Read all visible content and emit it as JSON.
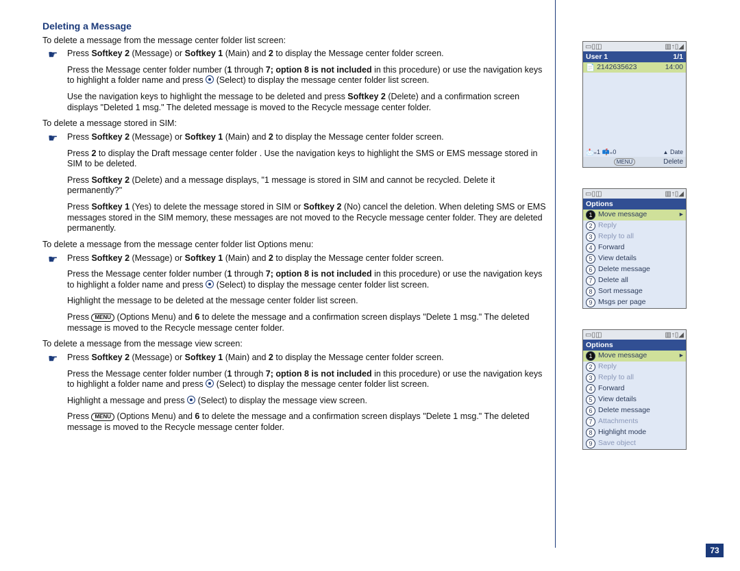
{
  "page_number": "73",
  "heading": "Deleting a Message",
  "intro1": "To delete a message from the message center folder list screen:",
  "b1a_pre": "Press ",
  "b1a_sk2": "Softkey 2",
  "b1a_mid1": " (Message) or ",
  "b1a_sk1": "Softkey 1",
  "b1a_mid2": " (Main) and ",
  "b1a_two": "2",
  "b1a_post": " to display the Message center folder screen.",
  "b1b_pre": "Press the Message center folder number (",
  "b1b_one": "1",
  "b1b_mid1": " through ",
  "b1b_seven": "7; option 8 is not included",
  "b1b_mid2": " in this procedure) or use the navigation keys to highlight a folder name and press ",
  "b1b_post": " (Select) to display the message center folder list screen.",
  "b1c_pre": "Use the navigation keys to highlight the message to be deleted and press ",
  "b1c_sk2": "Softkey 2",
  "b1c_post": " (Delete) and a confirmation screen displays \"Deleted 1 msg.\" The deleted message is moved to the Recycle message center folder.",
  "intro2": "To delete a message stored in SIM:",
  "b2b_pre": "Press ",
  "b2b_two": "2",
  "b2b_post": " to display the Draft message center folder . Use the navigation keys to highlight the SMS or EMS message stored in SIM to be deleted.",
  "b2c_pre": "Press ",
  "b2c_sk2": "Softkey 2",
  "b2c_post": " (Delete) and a message displays, \"1 message is stored in SIM and cannot be recycled. Delete it permanently?\"",
  "b2d_pre": "Press ",
  "b2d_sk1": "Softkey 1",
  "b2d_mid": " (Yes) to delete the message stored in SIM or ",
  "b2d_sk2": "Softkey 2",
  "b2d_post": " (No) cancel the deletion. When deleting SMS or EMS messages stored in the SIM memory, these messages are not moved to the Recycle message center folder. They are deleted permanently.",
  "intro3": "To delete a message from the message center folder list Options menu:",
  "b3c": "Highlight the message to be deleted at the message center folder list screen.",
  "b3d_pre": "Press ",
  "b3d_mid": " (Options Menu) and ",
  "b3d_six": "6",
  "b3d_post": " to delete the message and a confirmation screen displays \"Delete 1 msg.\" The deleted message is moved to the Recycle message center folder.",
  "intro4": "To delete a message from the message view screen:",
  "b4c_pre": "Highlight a message and press ",
  "b4c_post": " (Select) to display the message view screen.",
  "phone1": {
    "title_left": "User 1",
    "title_right": "1/1",
    "row_num": "2142635623",
    "row_time": "14:00",
    "foot_left": "📩₌1   📫₌0",
    "foot_mid": "MENU",
    "foot_right": "Delete",
    "date_label": "Date"
  },
  "phone2": {
    "title": "Options",
    "items": [
      {
        "n": "1",
        "t": "Move message",
        "hl": true
      },
      {
        "n": "2",
        "t": "Reply",
        "dim": true
      },
      {
        "n": "3",
        "t": "Reply to all",
        "dim": true
      },
      {
        "n": "4",
        "t": "Forward"
      },
      {
        "n": "5",
        "t": "View details"
      },
      {
        "n": "6",
        "t": "Delete message"
      },
      {
        "n": "7",
        "t": "Delete all"
      },
      {
        "n": "8",
        "t": "Sort message"
      },
      {
        "n": "9",
        "t": "Msgs per page"
      }
    ]
  },
  "phone3": {
    "title": "Options",
    "items": [
      {
        "n": "1",
        "t": "Move message",
        "hl": true
      },
      {
        "n": "2",
        "t": "Reply",
        "dim": true
      },
      {
        "n": "3",
        "t": "Reply to all",
        "dim": true
      },
      {
        "n": "4",
        "t": "Forward"
      },
      {
        "n": "5",
        "t": "View details"
      },
      {
        "n": "6",
        "t": "Delete message"
      },
      {
        "n": "7",
        "t": "Attachments",
        "dim": true
      },
      {
        "n": "8",
        "t": "Highlight mode"
      },
      {
        "n": "9",
        "t": "Save object",
        "dim": true
      }
    ]
  },
  "menu_word": "MENU"
}
